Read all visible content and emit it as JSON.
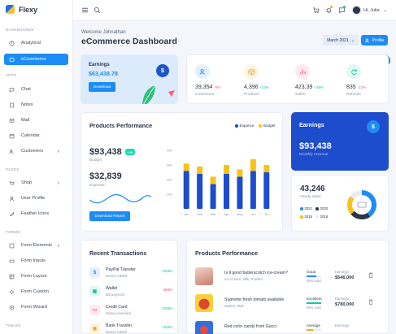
{
  "brand": {
    "name": "Flexy"
  },
  "sidebar": {
    "sections": [
      {
        "label": "DASHBOARDS"
      },
      {
        "label": "APPS"
      },
      {
        "label": "PAGES"
      },
      {
        "label": "FORMS"
      },
      {
        "label": "TABLES"
      }
    ],
    "items": [
      {
        "label": "Analytical",
        "icon": "analytics-icon"
      },
      {
        "label": "eCommerce",
        "icon": "cart-icon",
        "active": true
      },
      {
        "label": "Chat",
        "icon": "chat-icon"
      },
      {
        "label": "Notes",
        "icon": "notes-icon"
      },
      {
        "label": "Mail",
        "icon": "mail-icon"
      },
      {
        "label": "Calendar",
        "icon": "calendar-icon"
      },
      {
        "label": "Customers",
        "icon": "users-icon",
        "chevron": true
      },
      {
        "label": "Shop",
        "icon": "shop-icon",
        "chevron": true
      },
      {
        "label": "User Profile",
        "icon": "user-icon"
      },
      {
        "label": "Feather Icons",
        "icon": "feather-icon"
      },
      {
        "label": "Form Elements",
        "icon": "form-icon",
        "chevron": true
      },
      {
        "label": "Form Inputs",
        "icon": "input-icon"
      },
      {
        "label": "Form Layout",
        "icon": "layout-icon"
      },
      {
        "label": "Form Custom",
        "icon": "custom-icon"
      },
      {
        "label": "Form Wizard",
        "icon": "wizard-icon"
      }
    ]
  },
  "topbar": {
    "user_label": "Hi, Julia"
  },
  "header": {
    "welcome": "Welcome Johnathan",
    "title": "eCommerce Dashboard",
    "month": "March 2021",
    "profile_btn": "Profile"
  },
  "earnings_card": {
    "title": "Earnings",
    "value": "$63,438.78",
    "button": "Download"
  },
  "stats": [
    {
      "value": "39,354",
      "pct": "-9%",
      "label": "Customers",
      "color": "#1d8cf5",
      "bg": "#e4f1fd",
      "trend": "down"
    },
    {
      "value": "4,396",
      "pct": "+23%",
      "label": "Products",
      "color": "#f8a51b",
      "bg": "#fdf3e2",
      "trend": "up"
    },
    {
      "value": "423,39",
      "pct": "+38%",
      "label": "Sales",
      "color": "#fa5a7d",
      "bg": "#fde9ee",
      "trend": "up"
    },
    {
      "value": "835",
      "pct": "-12%",
      "label": "Refunds",
      "color": "#13c7a0",
      "bg": "#e3f8f1",
      "trend": "down"
    }
  ],
  "products_performance": {
    "title": "Products Performance",
    "legend": [
      {
        "label": "Expance",
        "color": "#1d4ccc"
      },
      {
        "label": "Budget",
        "color": "#f8c21b"
      }
    ],
    "budget_value": "$93,438",
    "budget_chip": "+9%",
    "budget_label": "Budget",
    "expense_value": "$32,839",
    "expense_label": "Expense",
    "button": "Download Report"
  },
  "chart_data": {
    "type": "bar",
    "stacked": true,
    "categories": [
      "Jan",
      "Feb",
      "Mar",
      "Apr",
      "May",
      "Jun",
      "Jul"
    ],
    "series": [
      {
        "name": "Expance",
        "values": [
          260,
          240,
          170,
          240,
          220,
          260,
          250
        ],
        "color": "#1d4ccc"
      },
      {
        "name": "Budget",
        "values": [
          50,
          50,
          50,
          60,
          50,
          80,
          50
        ],
        "color": "#f8c21b"
      }
    ],
    "y_ticks": [
      400,
      300,
      200,
      100
    ],
    "ylim": [
      0,
      400
    ]
  },
  "earnings_blue": {
    "title": "Earnings",
    "value": "$93,438",
    "label": "Monthly revenue"
  },
  "yearly": {
    "value": "43,246",
    "label": "Yearly sales",
    "legend": [
      {
        "label": "2021",
        "color": "#1d8cf5"
      },
      {
        "label": "2020",
        "color": "#2a3547"
      },
      {
        "label": "2019",
        "color": "#f8c21b"
      },
      {
        "label": "2018",
        "color": "#e9edf3"
      }
    ]
  },
  "transactions": {
    "title": "Recent Transactions",
    "items": [
      {
        "name": "PayPal Transfer",
        "sub": "Money Added",
        "amount": "+$350",
        "color": "#13c7a0",
        "icon_bg": "#e4f1fd",
        "icon_color": "#1d8cf5",
        "icon_glyph": "$"
      },
      {
        "name": "Wallet",
        "sub": "Bill payment",
        "amount": "-$560",
        "color": "#fa5a7d",
        "icon_bg": "#e3f8f1",
        "icon_color": "#13c7a0",
        "icon_glyph": "▣"
      },
      {
        "name": "Credit Card",
        "sub": "Money reversed",
        "amount": "+$350",
        "color": "#13c7a0",
        "icon_bg": "#fde9ee",
        "icon_color": "#fa5a7d",
        "icon_glyph": "▭"
      },
      {
        "name": "Bank Transfer",
        "sub": "Money Added",
        "amount": "+$350",
        "color": "#13c7a0",
        "icon_bg": "#fdf3e2",
        "icon_color": "#f8a51b",
        "icon_glyph": "◼"
      }
    ]
  },
  "products_table": {
    "title": "Products Performance",
    "items": [
      {
        "name": "Is it good butterscotch ice-cream?",
        "sub": "Ice-Cream, Milk, Powder",
        "quality": "Good",
        "sold": "65% sold",
        "fill": 0.65,
        "fill_color": "#1d8cf5",
        "earn_label": "Earnings",
        "earnings": "$546,000",
        "img": "#e8b4a8"
      },
      {
        "name": "Supreme fresh tomato available",
        "sub": "Market, Mall",
        "quality": "Excellent",
        "sold": "98% sold",
        "fill": 0.98,
        "fill_color": "#13c7a0",
        "earn_label": "Earnings",
        "earnings": "$780,000",
        "img": "#e9c32a"
      },
      {
        "name": "Red color candy from Gucci",
        "sub": "",
        "quality": "Average",
        "sold": "",
        "fill": 0.45,
        "fill_color": "#f8a51b",
        "earn_label": "Earnings",
        "earnings": "",
        "img": "#2f6fe0"
      }
    ]
  }
}
